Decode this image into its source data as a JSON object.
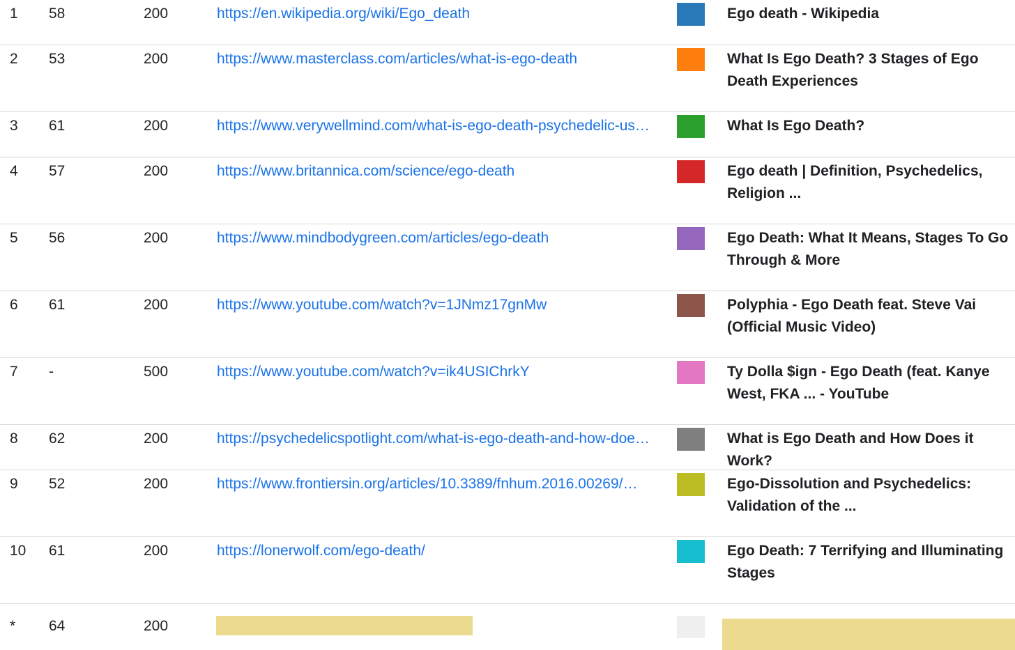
{
  "rows": [
    {
      "rank": "1",
      "score": "58",
      "status": "200",
      "url": "https://en.wikipedia.org/wiki/Ego_death",
      "color": "#2a7ab9",
      "title": "Ego death - Wikipedia"
    },
    {
      "rank": "2",
      "score": "53",
      "status": "200",
      "url": "https://www.masterclass.com/articles/what-is-ego-death",
      "color": "#ff7f0e",
      "title": "What Is Ego Death? 3 Stages of Ego Death Experiences"
    },
    {
      "rank": "3",
      "score": "61",
      "status": "200",
      "url": "https://www.verywellmind.com/what-is-ego-death-psychedelic-us…",
      "color": "#2ca02c",
      "title": "What Is Ego Death?"
    },
    {
      "rank": "4",
      "score": "57",
      "status": "200",
      "url": "https://www.britannica.com/science/ego-death",
      "color": "#d62728",
      "title": "Ego death | Definition, Psychedelics, Religion ..."
    },
    {
      "rank": "5",
      "score": "56",
      "status": "200",
      "url": "https://www.mindbodygreen.com/articles/ego-death",
      "color": "#9467bd",
      "title": "Ego Death: What It Means, Stages To Go Through & More"
    },
    {
      "rank": "6",
      "score": "61",
      "status": "200",
      "url": "https://www.youtube.com/watch?v=1JNmz17gnMw",
      "color": "#8c564b",
      "title": "Polyphia - Ego Death feat. Steve Vai (Official Music Video)"
    },
    {
      "rank": "7",
      "score": "-",
      "status": "500",
      "url": "https://www.youtube.com/watch?v=ik4USIChrkY",
      "color": "#e377c2",
      "title": "Ty Dolla $ign - Ego Death (feat. Kanye West, FKA ... - YouTube"
    },
    {
      "rank": "8",
      "score": "62",
      "status": "200",
      "url": "https://psychedelicspotlight.com/what-is-ego-death-and-how-doe…",
      "color": "#7f7f7f",
      "title": "What is Ego Death and How Does it Work?"
    },
    {
      "rank": "9",
      "score": "52",
      "status": "200",
      "url": "https://www.frontiersin.org/articles/10.3389/fnhum.2016.00269/…",
      "color": "#bcbd22",
      "title": "Ego-Dissolution and Psychedelics: Validation of the ..."
    },
    {
      "rank": "10",
      "score": "61",
      "status": "200",
      "url": "https://lonerwolf.com/ego-death/",
      "color": "#17becf",
      "title": "Ego Death: 7 Terrifying and Illuminating Stages"
    }
  ],
  "summary_row": {
    "rank": "*",
    "score": "64",
    "status": "200"
  }
}
